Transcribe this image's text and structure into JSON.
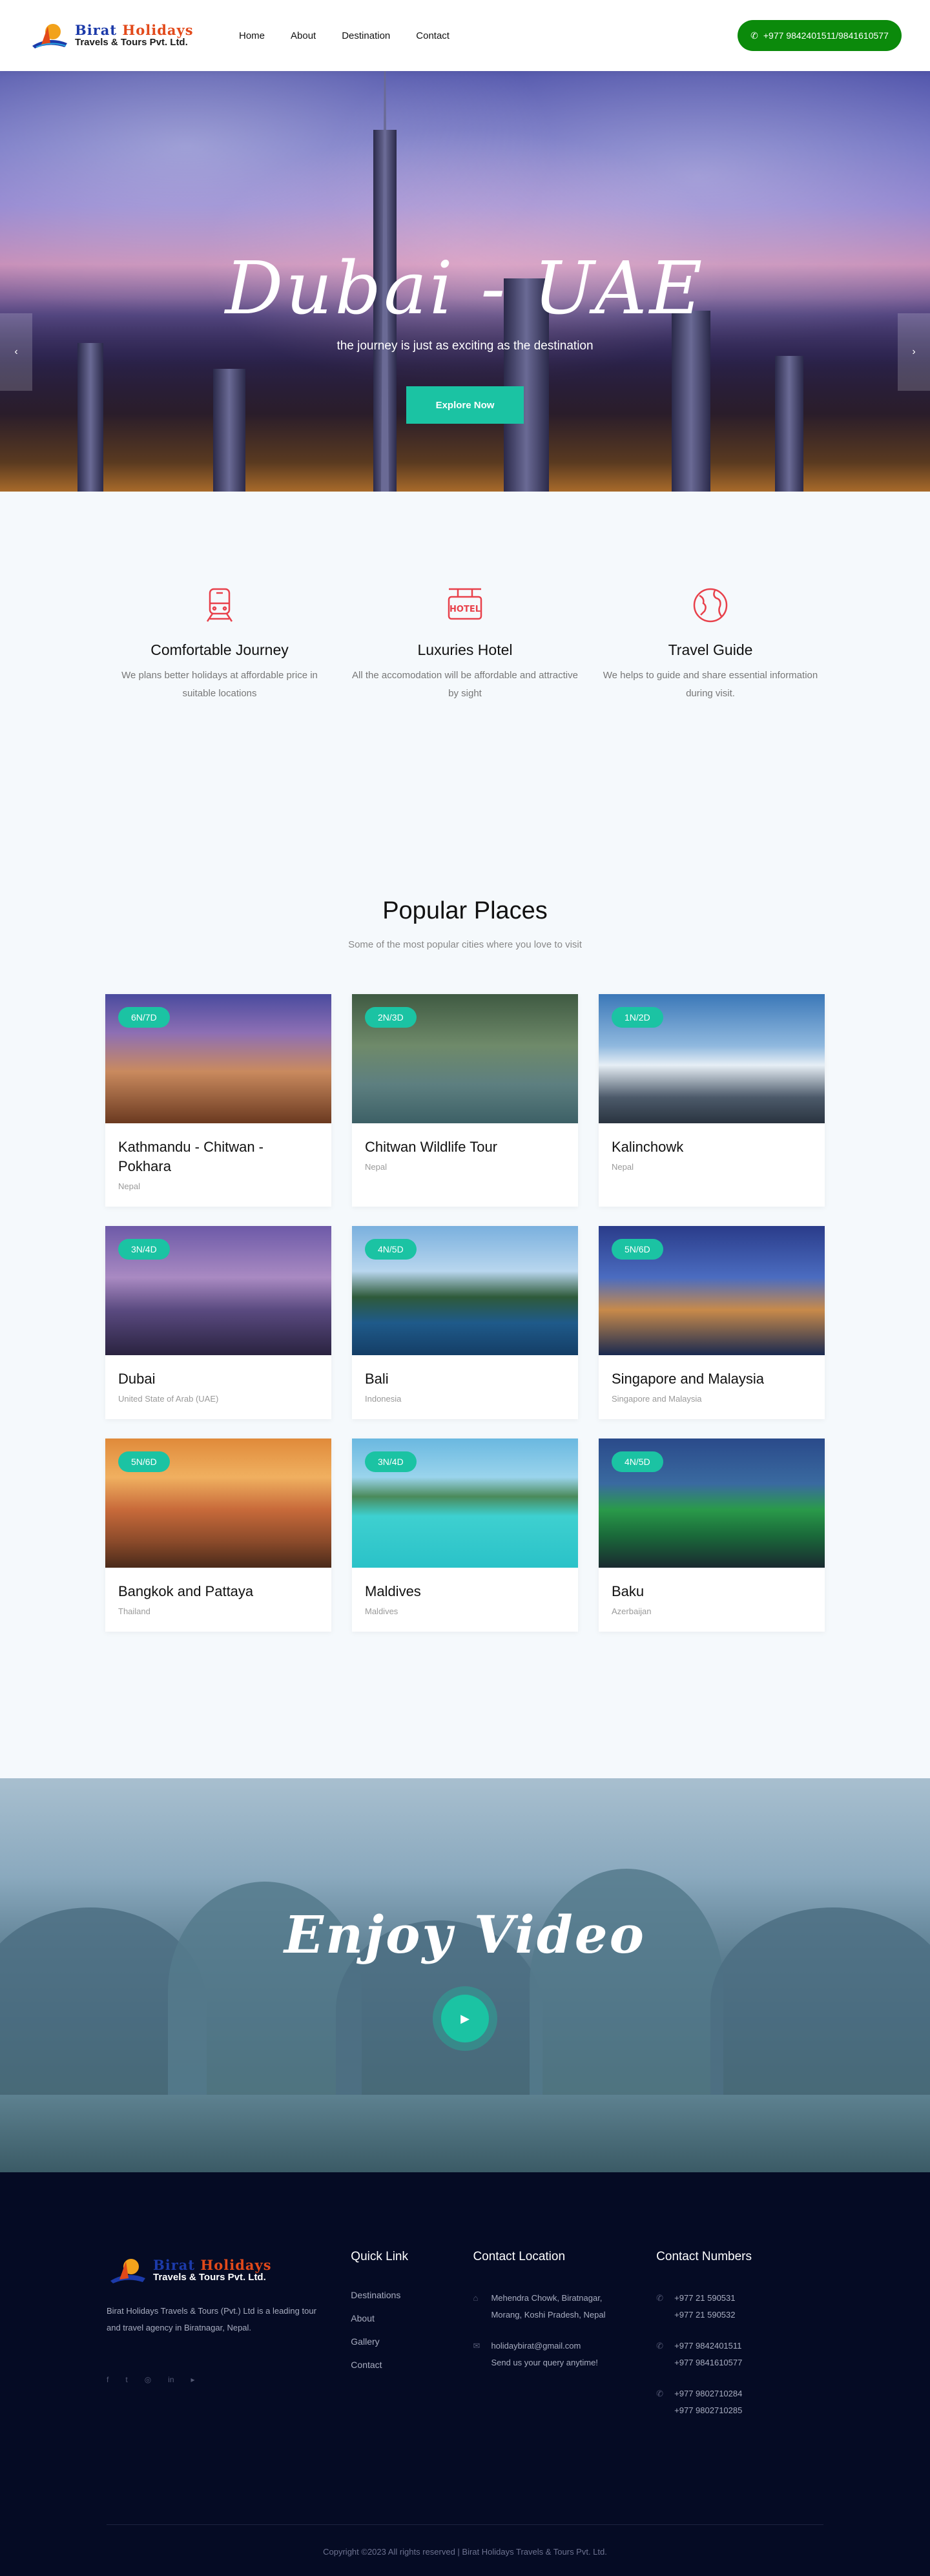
{
  "brand": {
    "name_part1": "Birat",
    "name_part2": "Holidays",
    "tagline": "Travels & Tours Pvt. Ltd."
  },
  "nav": {
    "items": [
      "Home",
      "About",
      "Destination",
      "Contact"
    ]
  },
  "header": {
    "phone": "+977 9842401511/9841610577"
  },
  "hero": {
    "title": "Dubai - UAE",
    "subtitle": "the journey is just as exciting as the destination",
    "button": "Explore Now"
  },
  "features": [
    {
      "icon": "train-icon",
      "title": "Comfortable Journey",
      "text": "We plans better holidays at affordable price in suitable locations"
    },
    {
      "icon": "hotel-icon",
      "title": "Luxuries Hotel",
      "text": "All the accomodation will be affordable and attractive by sight"
    },
    {
      "icon": "globe-icon",
      "title": "Travel Guide",
      "text": "We helps to guide and share essential information during visit."
    }
  ],
  "popular": {
    "title": "Popular Places",
    "subtitle": "Some of the most popular cities where you love to visit",
    "places": [
      {
        "badge": "6N/7D",
        "name": "Kathmandu - Chitwan - Pokhara",
        "location": "Nepal"
      },
      {
        "badge": "2N/3D",
        "name": "Chitwan Wildlife Tour",
        "location": "Nepal"
      },
      {
        "badge": "1N/2D",
        "name": "Kalinchowk",
        "location": "Nepal"
      },
      {
        "badge": "3N/4D",
        "name": "Dubai",
        "location": "United State of Arab (UAE)"
      },
      {
        "badge": "4N/5D",
        "name": "Bali",
        "location": "Indonesia"
      },
      {
        "badge": "5N/6D",
        "name": "Singapore and Malaysia",
        "location": "Singapore and Malaysia"
      },
      {
        "badge": "5N/6D",
        "name": "Bangkok and Pattaya",
        "location": "Thailand"
      },
      {
        "badge": "3N/4D",
        "name": "Maldives",
        "location": "Maldives"
      },
      {
        "badge": "4N/5D",
        "name": "Baku",
        "location": "Azerbaijan"
      }
    ]
  },
  "video": {
    "title": "Enjoy Video"
  },
  "footer": {
    "about": "Birat Holidays Travels & Tours (Pvt.) Ltd is a leading tour and travel agency in Biratnagar, Nepal.",
    "quick_link_title": "Quick Link",
    "quick_links": [
      "Destinations",
      "About",
      "Gallery",
      "Contact"
    ],
    "location_title": "Contact Location",
    "address_line1": "Mehendra Chowk, Biratnagar,",
    "address_line2": "Morang, Koshi Pradesh, Nepal",
    "email": "holidaybirat@gmail.com",
    "email_note": "Send us your query anytime!",
    "numbers_title": "Contact Numbers",
    "numbers": [
      [
        "+977 21 590531",
        "+977 21 590532"
      ],
      [
        "+977 9842401511",
        "+977 9841610577"
      ],
      [
        "+977 9802710284",
        "+977 9802710285"
      ]
    ],
    "copyright": "Copyright ©2023 All rights reserved | Birat Holidays Travels & Tours Pvt. Ltd."
  },
  "colors": {
    "accent": "#1bc3a3",
    "phone_button": "#0b8a0b",
    "feature_icon": "#e8414b",
    "footer_bg": "#050b24"
  }
}
